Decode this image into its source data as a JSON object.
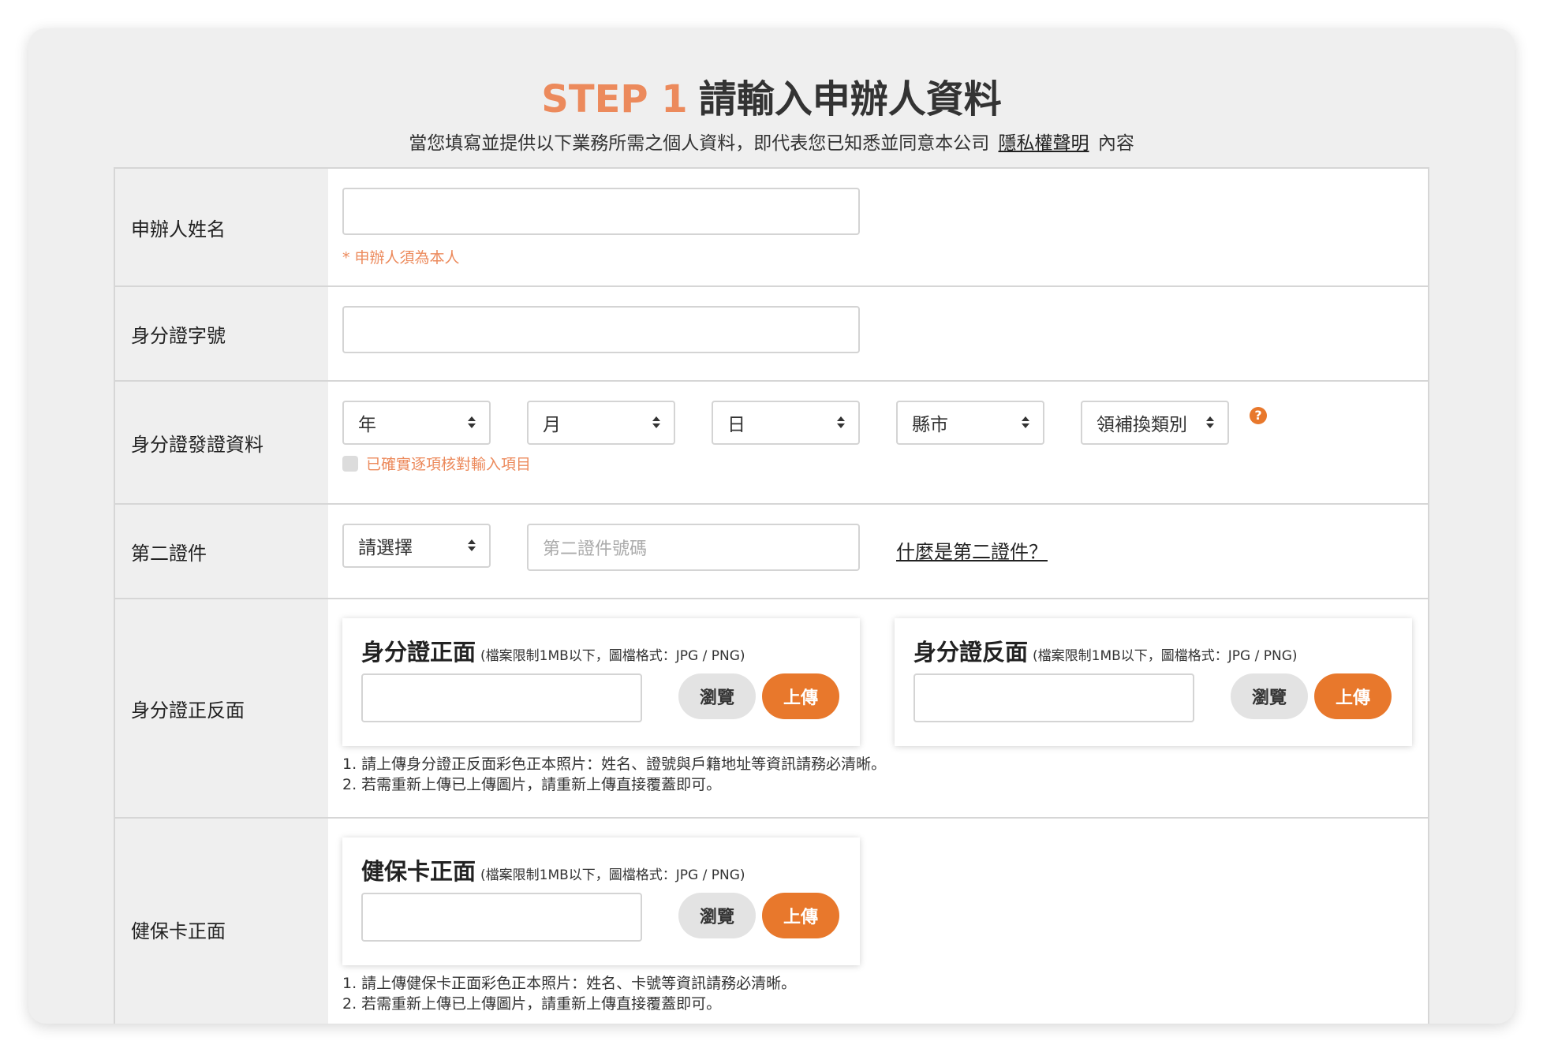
{
  "header": {
    "step": "STEP 1",
    "title": "請輸入申辦人資料",
    "subtitle_pre": "當您填寫並提供以下業務所需之個人資料，即代表您已知悉並同意本公司",
    "privacy_link": "隱私權聲明",
    "subtitle_post": "內容"
  },
  "rows": {
    "applicant_name": {
      "label": "申辦人姓名",
      "hint": "* 申辦人須為本人"
    },
    "id_number": {
      "label": "身分證字號"
    },
    "id_issue": {
      "label": "身分證發證資料",
      "year": "年",
      "month": "月",
      "day": "日",
      "city": "縣市",
      "type": "領補換類別",
      "help": "?",
      "confirm": "已確實逐項核對輸入項目"
    },
    "second_id": {
      "label": "第二證件",
      "select": "請選擇",
      "placeholder": "第二證件號碼",
      "link": "什麼是第二證件？"
    },
    "id_card": {
      "label": "身分證正反面",
      "front_title": "身分證正面",
      "back_title": "身分證反面",
      "note": "(檔案限制1MB以下，圖檔格式：JPG / PNG)",
      "browse": "瀏覽",
      "upload": "上傳",
      "notes": [
        "1. 請上傳身分證正反面彩色正本照片：姓名、證號與戶籍地址等資訊請務必清晰。",
        "2. 若需重新上傳已上傳圖片，請重新上傳直接覆蓋即可。"
      ]
    },
    "health_card": {
      "label": "健保卡正面",
      "front_title": "健保卡正面",
      "note": "(檔案限制1MB以下，圖檔格式：JPG / PNG)",
      "browse": "瀏覽",
      "upload": "上傳",
      "notes": [
        "1. 請上傳健保卡正面彩色正本照片：姓名、卡號等資訊請務必清晰。",
        "2. 若需重新上傳已上傳圖片，請重新上傳直接覆蓋即可。"
      ]
    }
  },
  "colors": {
    "accent": "#e8782c",
    "step": "#ec8a5c"
  }
}
